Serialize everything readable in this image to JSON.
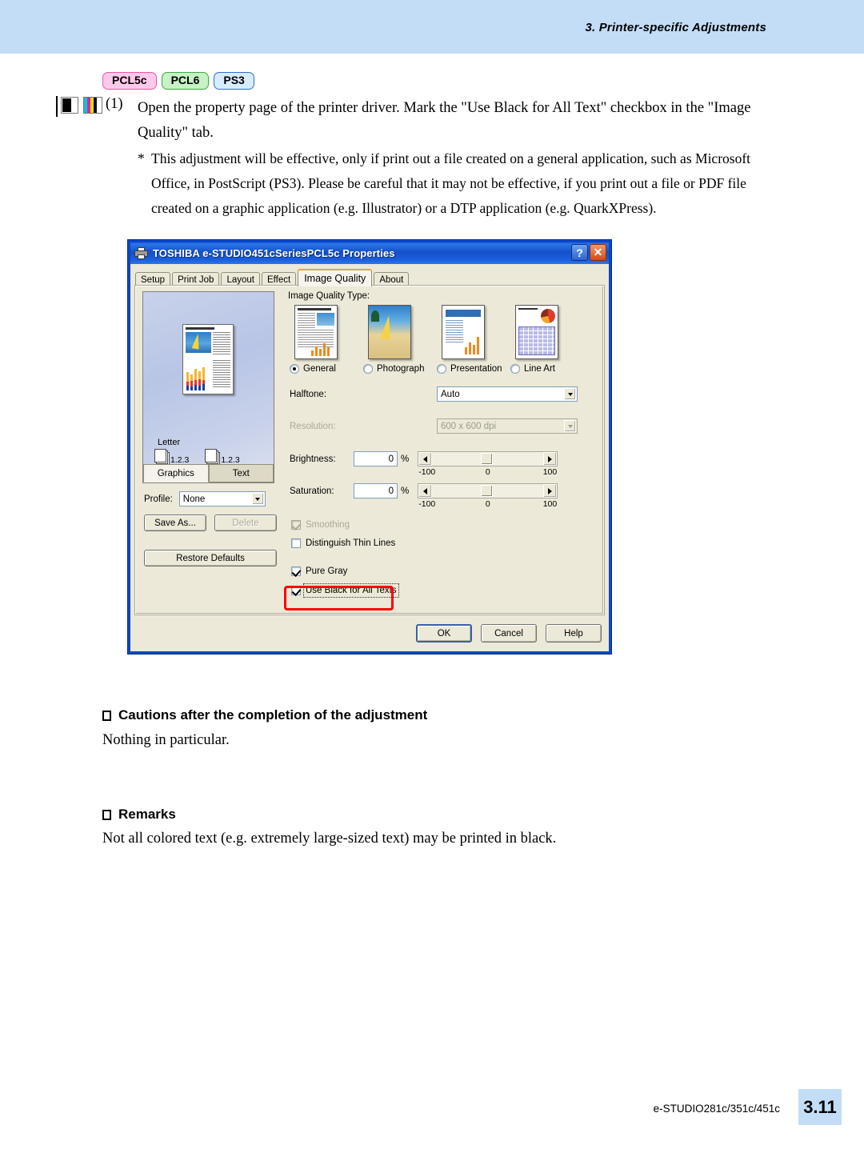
{
  "header": {
    "title": "3. Printer-specific Adjustments"
  },
  "badges": [
    {
      "label": "PCL5c"
    },
    {
      "label": "PCL6"
    },
    {
      "label": "PS3"
    }
  ],
  "step": {
    "number": "(1)",
    "text": "Open the property page of the printer driver.  Mark the \"Use Black for All Text\" checkbox in the \"Image Quality\" tab.",
    "note_marker": "*",
    "note": "This adjustment will be effective, only if print out a file created on a general application, such as Microsoft Office, in PostScript (PS3).  Please be careful that it may not be effective, if you print out a file or PDF file created on a graphic application (e.g. Illustrator) or a DTP application (e.g. QuarkXPress)."
  },
  "dialog": {
    "title": "TOSHIBA e-STUDIO451cSeriesPCL5c Properties",
    "titlebar_buttons": {
      "help": "?",
      "close": "✕"
    },
    "tabs": [
      {
        "label": "Setup",
        "active": false
      },
      {
        "label": "Print Job",
        "active": false
      },
      {
        "label": "Layout",
        "active": false
      },
      {
        "label": "Effect",
        "active": false
      },
      {
        "label": "Image Quality",
        "active": true
      },
      {
        "label": "About",
        "active": false
      }
    ],
    "preview": {
      "paper_label": "Letter",
      "stack_label_1": "1.2.3",
      "stack_label_2": "1.2.3",
      "tabs": [
        {
          "label": "Graphics",
          "active": true
        },
        {
          "label": "Text",
          "active": false
        }
      ]
    },
    "profile": {
      "label": "Profile:",
      "value": "None",
      "save_as": "Save As...",
      "delete": "Delete",
      "restore_defaults": "Restore Defaults"
    },
    "image_quality_type": {
      "label": "Image Quality Type:",
      "options": [
        {
          "label": "General",
          "selected": true
        },
        {
          "label": "Photograph",
          "selected": false
        },
        {
          "label": "Presentation",
          "selected": false
        },
        {
          "label": "Line Art",
          "selected": false
        }
      ]
    },
    "halftone": {
      "label": "Halftone:",
      "value": "Auto"
    },
    "resolution": {
      "label": "Resolution:",
      "value": "600 x 600 dpi",
      "disabled": true
    },
    "brightness": {
      "label": "Brightness:",
      "value": "0",
      "unit": "%",
      "min": "-100",
      "mid": "0",
      "max": "100"
    },
    "saturation": {
      "label": "Saturation:",
      "value": "0",
      "unit": "%",
      "min": "-100",
      "mid": "0",
      "max": "100"
    },
    "checkboxes": [
      {
        "label": "Smoothing",
        "checked": true,
        "disabled": true
      },
      {
        "label": "Distinguish Thin Lines",
        "checked": false,
        "disabled": false
      },
      {
        "label": "Pure Gray",
        "checked": true,
        "disabled": false
      },
      {
        "label": "Use Black for All Texts",
        "checked": true,
        "disabled": false,
        "highlighted": true
      }
    ],
    "buttons": [
      {
        "label": "OK",
        "default": true
      },
      {
        "label": "Cancel",
        "default": false
      },
      {
        "label": "Help",
        "default": false
      }
    ]
  },
  "sections": [
    {
      "heading": "Cautions after the completion of the adjustment",
      "body": "Nothing in particular."
    },
    {
      "heading": "Remarks",
      "body": "Not all colored text (e.g. extremely large-sized text) may be printed in black."
    }
  ],
  "footer": {
    "model": "e-STUDIO281c/351c/451c",
    "page": "3.11"
  },
  "colors": {
    "header_band": "#c3ddf7",
    "badge_pcl5c": "#ffc9ec",
    "badge_pcl6": "#c6f2c6",
    "badge_ps3": "#d7ecff",
    "dialog_face": "#ece9d8",
    "titlebar": "#1351c8",
    "highlight": "#ff0000"
  }
}
